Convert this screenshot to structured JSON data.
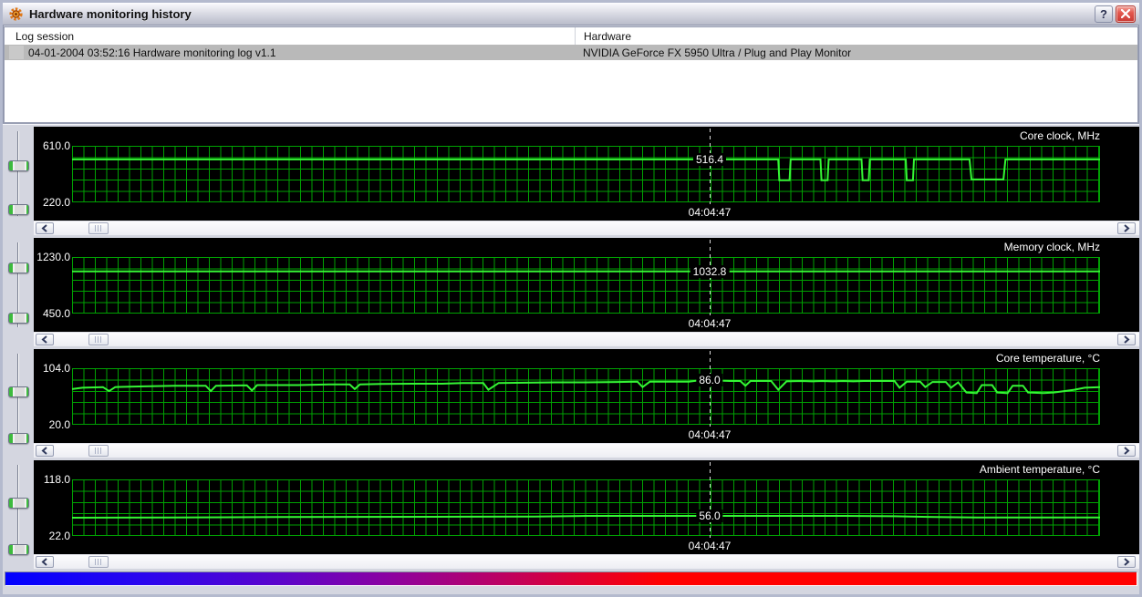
{
  "window": {
    "title": "Hardware monitoring history",
    "help_glyph": "?"
  },
  "icons": {
    "app": "gear-icon",
    "help": "question-mark-icon",
    "close": "x-close-icon",
    "scroll_left": "chevron-left-icon",
    "scroll_right": "chevron-right-icon",
    "scroll_thumb": "grip-lines-icon"
  },
  "list": {
    "columns": [
      "Log session",
      "Hardware"
    ],
    "row": {
      "session": "04-01-2004 03:52:16 Hardware monitoring log v1.1",
      "hardware": "NVIDIA GeForce FX 5950 Ultra / Plug and Play Monitor"
    }
  },
  "colors": {
    "chart_bg": "#000000",
    "grid_line": "#00a202",
    "trace": "#35f535",
    "selection_bg": "#b9b9b9",
    "gradient_left": "#0000ff",
    "gradient_right": "#ff0000"
  },
  "panels": [
    {
      "title": "Core clock, MHz",
      "max_label": "610.0",
      "min_label": "220.0",
      "value_label": "516.4",
      "value_num": 516.4,
      "time_label": "04:04:47",
      "ymax": 610,
      "ymin": 220,
      "thumbs": [
        0.42,
        0.88
      ],
      "series": [
        [
          0,
          516.4
        ],
        [
          0.687,
          516.4
        ],
        [
          0.688,
          372
        ],
        [
          0.698,
          372
        ],
        [
          0.699,
          516.4
        ],
        [
          0.728,
          516.4
        ],
        [
          0.729,
          372
        ],
        [
          0.735,
          372
        ],
        [
          0.736,
          516.4
        ],
        [
          0.768,
          516.4
        ],
        [
          0.769,
          372
        ],
        [
          0.775,
          372
        ],
        [
          0.776,
          516.4
        ],
        [
          0.811,
          516.4
        ],
        [
          0.812,
          372
        ],
        [
          0.818,
          372
        ],
        [
          0.819,
          516.4
        ],
        [
          0.873,
          516.4
        ],
        [
          0.875,
          378
        ],
        [
          0.906,
          378
        ],
        [
          0.908,
          516.4
        ],
        [
          1,
          516.4
        ]
      ]
    },
    {
      "title": "Memory clock, MHz",
      "max_label": "1230.0",
      "min_label": "450.0",
      "value_label": "1032.8",
      "value_num": 1032.8,
      "time_label": "04:04:47",
      "ymax": 1230,
      "ymin": 450,
      "thumbs": [
        0.32,
        0.85
      ],
      "series": [
        [
          0,
          1032.8
        ],
        [
          1,
          1032.8
        ]
      ]
    },
    {
      "title": "Core temperature, °C",
      "max_label": "104.0",
      "min_label": "20.0",
      "value_label": "86.0",
      "value_num": 86.0,
      "time_label": "04:04:47",
      "ymax": 104,
      "ymin": 20,
      "thumbs": [
        0.46,
        0.95
      ],
      "series": [
        [
          0,
          73
        ],
        [
          0.01,
          75
        ],
        [
          0.03,
          76
        ],
        [
          0.036,
          70
        ],
        [
          0.042,
          76
        ],
        [
          0.07,
          77
        ],
        [
          0.1,
          78
        ],
        [
          0.13,
          78
        ],
        [
          0.135,
          70
        ],
        [
          0.14,
          78
        ],
        [
          0.17,
          78.5
        ],
        [
          0.175,
          71
        ],
        [
          0.18,
          79
        ],
        [
          0.22,
          79
        ],
        [
          0.25,
          80
        ],
        [
          0.27,
          80
        ],
        [
          0.275,
          73
        ],
        [
          0.28,
          80
        ],
        [
          0.3,
          80.5
        ],
        [
          0.33,
          81
        ],
        [
          0.36,
          81
        ],
        [
          0.38,
          82
        ],
        [
          0.4,
          82
        ],
        [
          0.405,
          72
        ],
        [
          0.415,
          82
        ],
        [
          0.44,
          82.5
        ],
        [
          0.47,
          83
        ],
        [
          0.5,
          83
        ],
        [
          0.53,
          83.5
        ],
        [
          0.55,
          84
        ],
        [
          0.555,
          76
        ],
        [
          0.562,
          84
        ],
        [
          0.6,
          84
        ],
        [
          0.61,
          86
        ],
        [
          0.62,
          86
        ],
        [
          0.64,
          85
        ],
        [
          0.65,
          85
        ],
        [
          0.655,
          78
        ],
        [
          0.66,
          85
        ],
        [
          0.68,
          85
        ],
        [
          0.687,
          72
        ],
        [
          0.695,
          84.5
        ],
        [
          0.71,
          85
        ],
        [
          0.72,
          84.5
        ],
        [
          0.73,
          85
        ],
        [
          0.74,
          84.5
        ],
        [
          0.75,
          85
        ],
        [
          0.76,
          84.5
        ],
        [
          0.77,
          85
        ],
        [
          0.8,
          85
        ],
        [
          0.805,
          75
        ],
        [
          0.812,
          84
        ],
        [
          0.825,
          84
        ],
        [
          0.83,
          76
        ],
        [
          0.837,
          83.5
        ],
        [
          0.85,
          83.5
        ],
        [
          0.855,
          75
        ],
        [
          0.862,
          83
        ],
        [
          0.87,
          68
        ],
        [
          0.88,
          67
        ],
        [
          0.885,
          79
        ],
        [
          0.895,
          79
        ],
        [
          0.9,
          68
        ],
        [
          0.91,
          67
        ],
        [
          0.915,
          78
        ],
        [
          0.925,
          78
        ],
        [
          0.93,
          68
        ],
        [
          0.945,
          67
        ],
        [
          0.955,
          68
        ],
        [
          0.965,
          70
        ],
        [
          0.975,
          72
        ],
        [
          0.985,
          75
        ],
        [
          1,
          76
        ]
      ]
    },
    {
      "title": "Ambient temperature, °C",
      "max_label": "118.0",
      "min_label": "22.0",
      "value_label": "56.0",
      "value_num": 56.0,
      "time_label": "04:04:47",
      "ymax": 118,
      "ymin": 22,
      "thumbs": [
        0.46,
        0.95
      ],
      "series": [
        [
          0,
          53
        ],
        [
          0.1,
          53.5
        ],
        [
          0.2,
          54
        ],
        [
          0.35,
          54.5
        ],
        [
          0.45,
          55
        ],
        [
          0.5,
          56
        ],
        [
          0.62,
          56
        ],
        [
          0.75,
          56
        ],
        [
          0.8,
          55.5
        ],
        [
          0.84,
          54
        ],
        [
          0.88,
          53.5
        ],
        [
          1,
          53.5
        ]
      ]
    }
  ]
}
